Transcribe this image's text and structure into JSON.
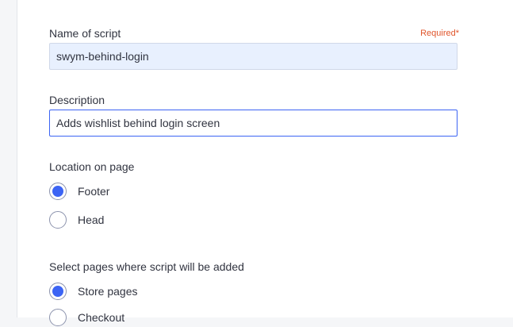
{
  "form": {
    "name_label": "Name of script",
    "required_label": "Required*",
    "name_value": "swym-behind-login",
    "description_label": "Description",
    "description_value": "Adds wishlist behind login screen",
    "location_label": "Location on page",
    "location_options": [
      {
        "label": "Footer",
        "checked": true
      },
      {
        "label": "Head",
        "checked": false
      }
    ],
    "pages_label": "Select pages where script will be added",
    "pages_options": [
      {
        "label": "Store pages",
        "checked": true
      },
      {
        "label": "Checkout",
        "checked": false
      }
    ]
  },
  "colors": {
    "accent": "#3c64f4",
    "required": "#e0552b",
    "autofill_bg": "#e8f0fe"
  }
}
